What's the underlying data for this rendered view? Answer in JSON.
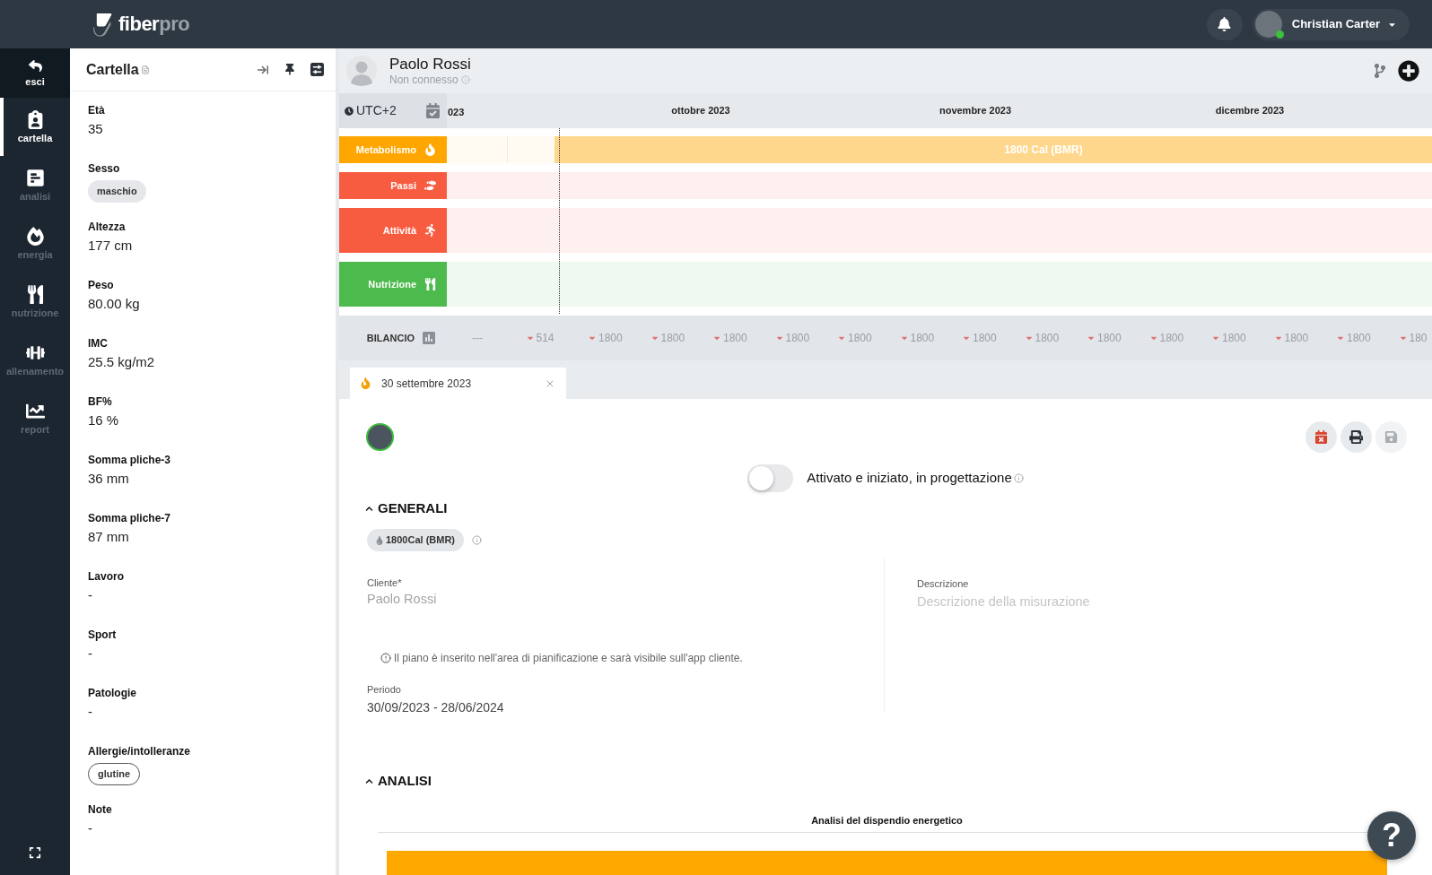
{
  "top_bar": {
    "logo": {
      "main": "fiber",
      "accent": "pro"
    },
    "user": {
      "name": "Christian Carter",
      "online": true
    }
  },
  "nav": {
    "items": [
      {
        "label": "esci",
        "kind": "exit",
        "selected": false
      },
      {
        "label": "cartella",
        "kind": "section",
        "selected": true
      },
      {
        "label": "analisi",
        "kind": "section",
        "selected": false
      },
      {
        "label": "energia",
        "kind": "section",
        "selected": false
      },
      {
        "label": "nutrizione",
        "kind": "section",
        "selected": false
      },
      {
        "label": "allenamento",
        "kind": "section",
        "selected": false
      },
      {
        "label": "report",
        "kind": "section",
        "selected": false
      }
    ]
  },
  "record_panel": {
    "title": "Cartella",
    "fields": [
      {
        "label": "Età",
        "value": "35",
        "kind": "text"
      },
      {
        "label": "Sesso",
        "value": "maschio",
        "kind": "tag"
      },
      {
        "label": "Altezza",
        "value": "177 cm",
        "kind": "text"
      },
      {
        "label": "Peso",
        "value": "80.00 kg",
        "kind": "text"
      },
      {
        "label": "IMC",
        "value": "25.5 kg/m2",
        "kind": "text"
      },
      {
        "label": "BF%",
        "value": "16 %",
        "kind": "text"
      },
      {
        "label": "Somma pliche-3",
        "value": "36 mm",
        "kind": "text"
      },
      {
        "label": "Somma pliche-7",
        "value": "87 mm",
        "kind": "text"
      },
      {
        "label": "Lavoro",
        "value": "-",
        "kind": "text"
      },
      {
        "label": "Sport",
        "value": "-",
        "kind": "text"
      },
      {
        "label": "Patologie",
        "value": "-",
        "kind": "text"
      },
      {
        "label": "Allergie/intolleranze",
        "value": "glutine",
        "kind": "outlined_tag"
      },
      {
        "label": "Note",
        "value": "-",
        "kind": "text"
      }
    ]
  },
  "client": {
    "name": "Paolo Rossi",
    "status": "Non connesso"
  },
  "timeline": {
    "timezone": "UTC+2",
    "months": [
      "023",
      "ottobre 2023",
      "novembre 2023",
      "dicembre 2023"
    ],
    "rows": [
      {
        "label": "Metabolismo",
        "color": "#ffa600",
        "bar_label": "1800 Cal (BMR)"
      },
      {
        "label": "Passi",
        "color": "#f75c41"
      },
      {
        "label": "Attività",
        "color": "#f75c41"
      },
      {
        "label": "Nutrizione",
        "color": "#4cba4c"
      }
    ],
    "balance": {
      "label": "BILANCIO",
      "values": [
        {
          "text": "---",
          "kind": "empty"
        },
        {
          "text": "514",
          "kind": "decrease"
        },
        {
          "text": "1800",
          "kind": "decrease"
        },
        {
          "text": "1800",
          "kind": "decrease"
        },
        {
          "text": "1800",
          "kind": "decrease"
        },
        {
          "text": "1800",
          "kind": "decrease"
        },
        {
          "text": "1800",
          "kind": "decrease"
        },
        {
          "text": "1800",
          "kind": "decrease"
        },
        {
          "text": "1800",
          "kind": "decrease"
        },
        {
          "text": "1800",
          "kind": "decrease"
        },
        {
          "text": "1800",
          "kind": "decrease"
        },
        {
          "text": "1800",
          "kind": "decrease"
        },
        {
          "text": "1800",
          "kind": "decrease"
        },
        {
          "text": "1800",
          "kind": "decrease"
        },
        {
          "text": "1800",
          "kind": "decrease"
        },
        {
          "text": "180",
          "kind": "decrease"
        }
      ]
    }
  },
  "tabs": [
    {
      "label": "30 settembre 2023",
      "selected": true
    }
  ],
  "plan": {
    "actions": [
      {
        "kind": "unschedule",
        "disabled": false
      },
      {
        "kind": "print",
        "disabled": false
      },
      {
        "kind": "save",
        "disabled": true
      }
    ],
    "toggle": {
      "label": "Attivato e iniziato, in progettazione",
      "on": false
    },
    "general": {
      "title": "GENERALI",
      "expanded": true,
      "badge": "1800Cal (BMR)",
      "client_label": "Cliente*",
      "client_value": "Paolo Rossi",
      "notice": "Il piano è inserito nell'area di pianificazione e sarà visibile sull'app cliente.",
      "period_label": "Periodo",
      "period_value": "30/09/2023 - 28/06/2024",
      "description_label": "Descrizione",
      "description_placeholder": "Descrizione della misurazione"
    },
    "analysis": {
      "title": "ANALISI",
      "expanded": true,
      "chart_title": "Analisi del dispendio energetico"
    }
  },
  "help": {
    "label": "?"
  }
}
